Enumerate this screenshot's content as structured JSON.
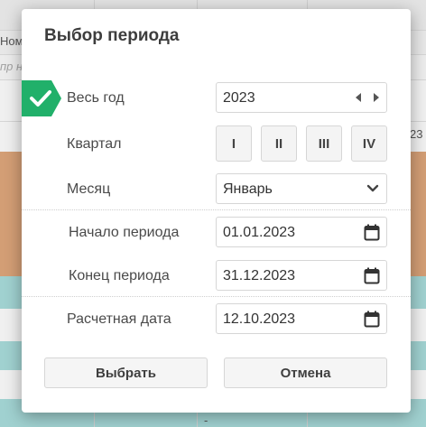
{
  "background_table": {
    "header_left": "Ном",
    "filter_left": "пр но",
    "cell_right": "23",
    "cell_right_dash": "-"
  },
  "dialog": {
    "title": "Выбор периода",
    "full_year": {
      "label": "Весь год",
      "checked": true,
      "value": "2023"
    },
    "quarter": {
      "label": "Квартал",
      "options": [
        "I",
        "II",
        "III",
        "IV"
      ]
    },
    "month": {
      "label": "Месяц",
      "value": "Январь"
    },
    "period_start": {
      "label": "Начало периода",
      "value": "01.01.2023"
    },
    "period_end": {
      "label": "Конец периода",
      "value": "31.12.2023"
    },
    "calc_date": {
      "label": "Расчетная дата",
      "value": "12.10.2023"
    },
    "buttons": {
      "select": "Выбрать",
      "cancel": "Отмена"
    }
  },
  "colors": {
    "accent_check": "#21b06a",
    "row_orange": "#e0a77a",
    "row_teal": "#a9dedd"
  }
}
